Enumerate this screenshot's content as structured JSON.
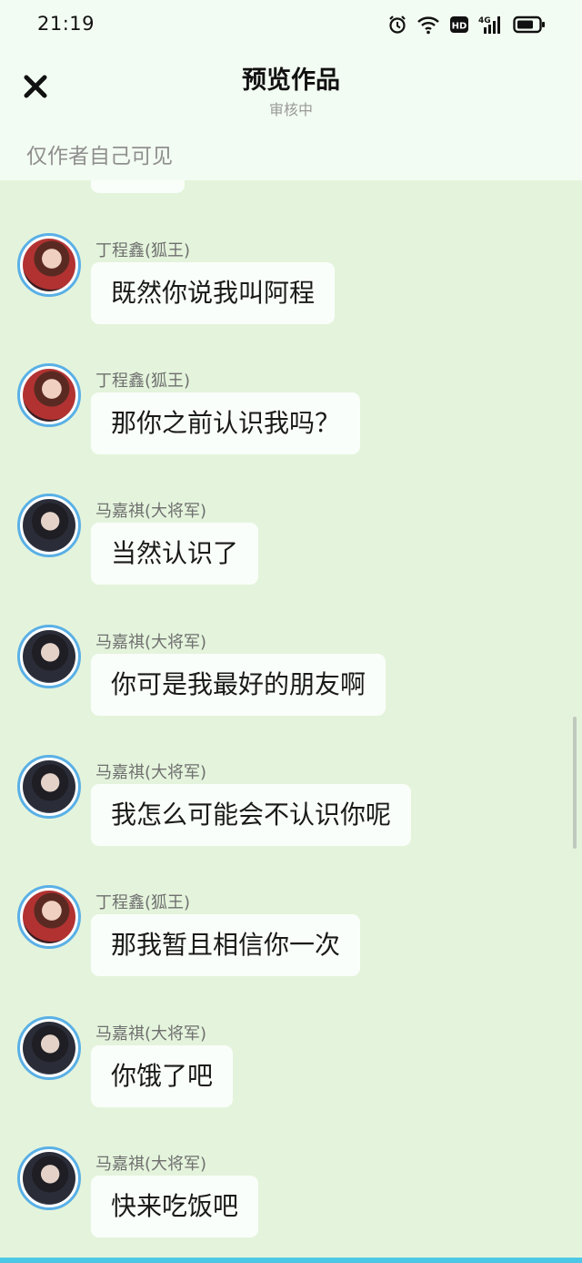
{
  "status": {
    "time": "21:19",
    "icons": [
      "alarm-icon",
      "wifi-icon",
      "hd-icon",
      "signal-4g-icon",
      "battery-icon"
    ],
    "hd_label": "HD",
    "network_label": "4G"
  },
  "header": {
    "close_icon": "close-icon",
    "title": "预览作品",
    "subtitle": "审核中",
    "visibility_note": "仅作者自己可见"
  },
  "colors": {
    "header_bg": "#f3fcf2",
    "chat_bg": "#e4f4dc",
    "bubble_bg": "#fafefa",
    "avatar_border": "#5ab0e6",
    "bottom_accent": "#4cc8e6"
  },
  "messages": [
    {
      "sender": "丁程鑫(狐王)",
      "text": "既然你说我叫阿程"
    },
    {
      "sender": "丁程鑫(狐王)",
      "text": "那你之前认识我吗？"
    },
    {
      "sender": "马嘉祺(大将军)",
      "text": "当然认识了"
    },
    {
      "sender": "马嘉祺(大将军)",
      "text": "你可是我最好的朋友啊"
    },
    {
      "sender": "马嘉祺(大将军)",
      "text": "我怎么可能会不认识你呢"
    },
    {
      "sender": "丁程鑫(狐王)",
      "text": "那我暂且相信你一次"
    },
    {
      "sender": "马嘉祺(大将军)",
      "text": "你饿了吧"
    },
    {
      "sender": "马嘉祺(大将军)",
      "text": "快来吃饭吧"
    }
  ]
}
